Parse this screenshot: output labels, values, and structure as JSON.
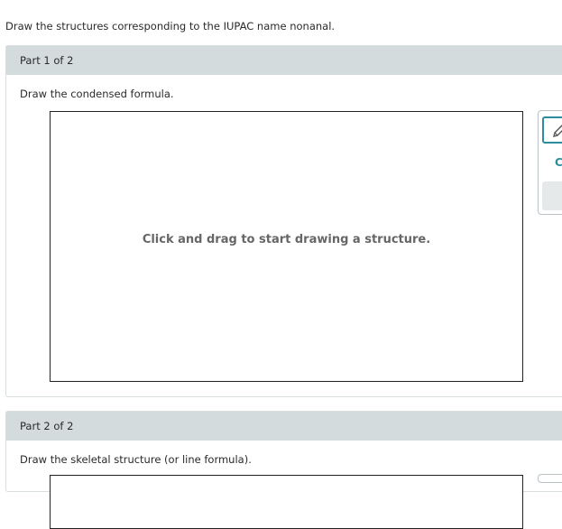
{
  "question": "Draw the structures corresponding to the IUPAC name nonanal.",
  "parts": [
    {
      "header": "Part 1 of 2",
      "instruction": "Draw the condensed formula.",
      "canvas_hint": "Click and drag to start drawing a structure."
    },
    {
      "header": "Part 2 of 2",
      "instruction": "Draw the skeletal structure (or line formula)."
    }
  ],
  "toolbar": {
    "tools": [
      "pencil-icon",
      "clear-icon"
    ],
    "accent_color": "#2a8e9e"
  }
}
